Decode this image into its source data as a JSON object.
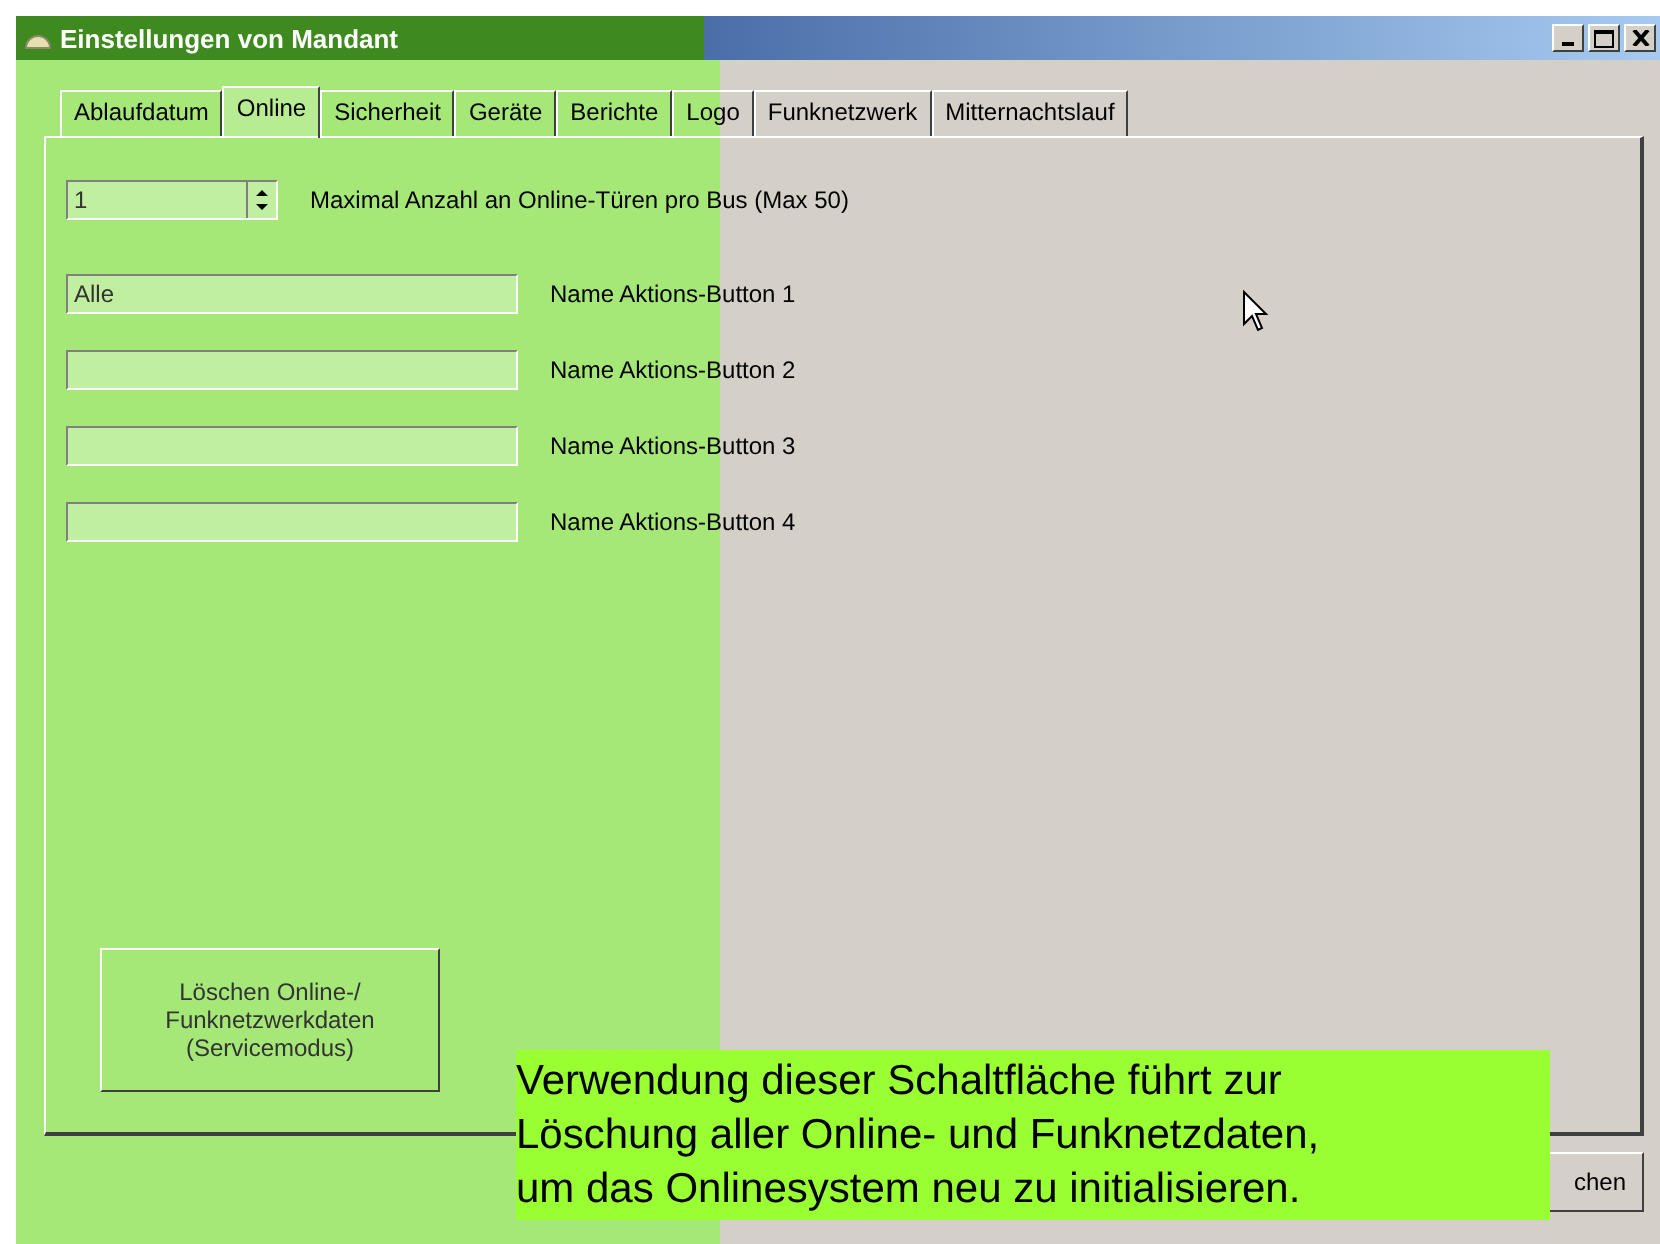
{
  "window": {
    "title": "Einstellungen von Mandant"
  },
  "tabs": [
    {
      "label": "Ablaufdatum",
      "selected": false
    },
    {
      "label": "Online",
      "selected": true
    },
    {
      "label": "Sicherheit",
      "selected": false
    },
    {
      "label": "Geräte",
      "selected": false
    },
    {
      "label": "Berichte",
      "selected": false
    },
    {
      "label": "Logo",
      "selected": false
    },
    {
      "label": "Funknetzwerk",
      "selected": false
    },
    {
      "label": "Mitternachtslauf",
      "selected": false
    }
  ],
  "spinner": {
    "value": "1",
    "label": "Maximal Anzahl an Online-Türen pro Bus (Max 50)"
  },
  "fields": [
    {
      "value": "Alle",
      "label": "Name Aktions-Button 1"
    },
    {
      "label": "Name Aktions-Button 2"
    },
    {
      "label": "Name Aktions-Button 3"
    },
    {
      "label": "Name Aktions-Button 4"
    }
  ],
  "service_button": {
    "label": "Löschen Online-/\nFunknetzwerkdaten\n(Servicemodus)"
  },
  "dialog_buttons": [
    {
      "label": "chen"
    }
  ],
  "tooltip": {
    "text": "Verwendung dieser Schaltfläche führt zur\nLöschung aller Online- und Funknetzdaten,\num das Onlinesystem neu zu initialisieren."
  }
}
